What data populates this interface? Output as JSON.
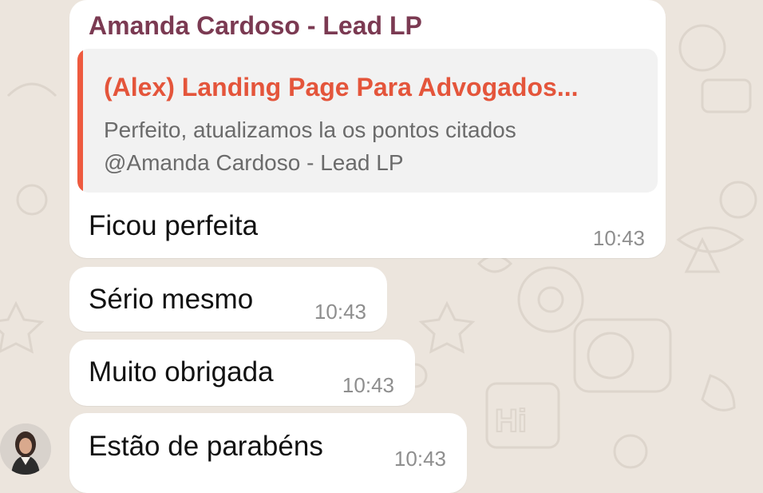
{
  "chat": {
    "first_message": {
      "sender": "Amanda Cardoso - Lead LP",
      "reply": {
        "title": "(Alex) Landing Page Para Advogados...",
        "line1": "Perfeito, atualizamos la os pontos citados",
        "line2": "@Amanda Cardoso - Lead LP"
      },
      "text": "Ficou perfeita",
      "time": "10:43"
    },
    "messages": [
      {
        "text": "Sério mesmo",
        "time": "10:43"
      },
      {
        "text": "Muito obrigada",
        "time": "10:43"
      },
      {
        "text": "Estão de parabéns",
        "time": "10:43"
      }
    ]
  },
  "colors": {
    "sender_name": "#7b3a52",
    "quote_accent": "#ee5a3f",
    "wallpaper": "#ece5dd",
    "bubble": "#ffffff"
  }
}
